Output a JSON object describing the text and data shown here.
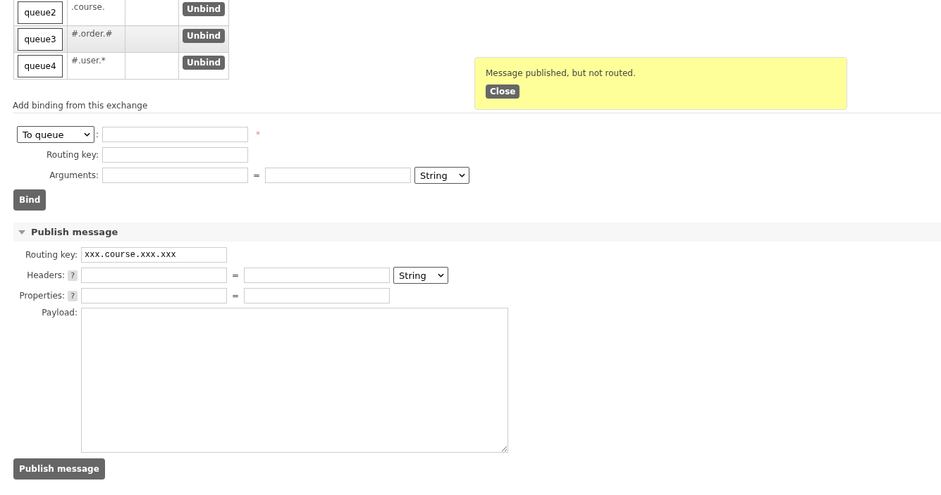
{
  "bindings": [
    {
      "queue": "queue2",
      "routing_key": ".course.",
      "action": "Unbind",
      "highlighted": false
    },
    {
      "queue": "queue3",
      "routing_key": "#.order.#",
      "action": "Unbind",
      "highlighted": true
    },
    {
      "queue": "queue4",
      "routing_key": "#.user.*",
      "action": "Unbind",
      "highlighted": false
    }
  ],
  "flash": {
    "message": "Message published, but not routed.",
    "button": "Close"
  },
  "add_binding": {
    "title": "Add binding from this exchange",
    "destination": "To queue",
    "colon": ":",
    "required_mark": "*",
    "routing_key_label": "Routing key:",
    "arguments_label": "Arguments:",
    "equals": "=",
    "type": "String",
    "button": "Bind"
  },
  "publish": {
    "title": "Publish message",
    "expanded": true,
    "routing_key_label": "Routing key:",
    "routing_key_value": "xxx.course.xxx.xxx",
    "headers_label": "Headers:",
    "properties_label": "Properties:",
    "help": "?",
    "equals": "=",
    "type": "String",
    "payload_label": "Payload:",
    "button": "Publish message"
  }
}
